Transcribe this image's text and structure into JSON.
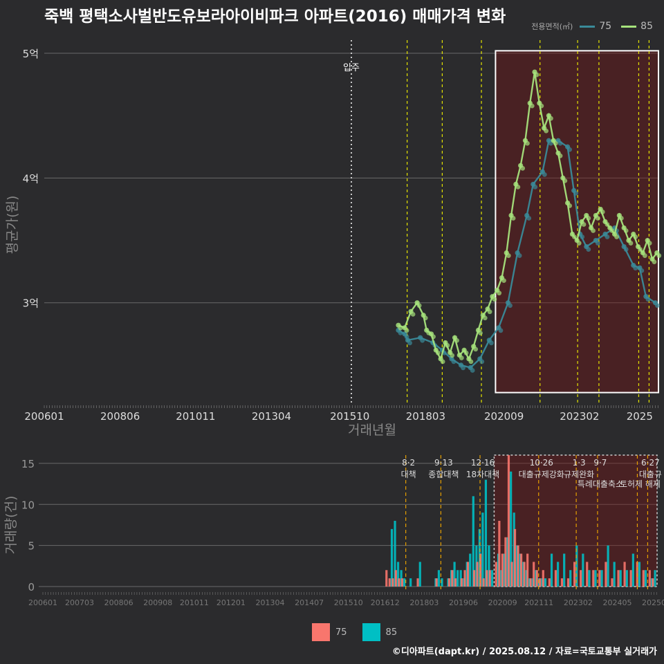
{
  "title": "죽백 평택소사벌반도유보라아이비파크 아파트(2016) 매매가격 변화",
  "legend": {
    "label": "전용면적(㎡)",
    "items": [
      {
        "name": "75",
        "line_color": "#3a8a99",
        "bar_color": "#f8766d"
      },
      {
        "name": "85",
        "line_color": "#a6e37c",
        "bar_color": "#00bfc4"
      }
    ]
  },
  "footer": "©디아파트(dapt.kr) / 2025.08.12 / 자료=국토교통부 실거래가",
  "chart_data": [
    {
      "type": "line",
      "xlabel": "거래년월",
      "ylabel": "평균가(원)",
      "ylim": [
        2.2,
        5.05
      ],
      "yticks": [
        {
          "v": 3,
          "label": "3억"
        },
        {
          "v": 4,
          "label": "4억"
        },
        {
          "v": 5,
          "label": "5억"
        }
      ],
      "xlim": [
        2006.0,
        2025.6
      ],
      "xticks": [
        {
          "v": 2006.0,
          "label": "200601"
        },
        {
          "v": 2008.42,
          "label": "200806"
        },
        {
          "v": 2010.83,
          "label": "201011"
        },
        {
          "v": 2013.25,
          "label": "201304"
        },
        {
          "v": 2015.75,
          "label": "201510"
        },
        {
          "v": 2018.17,
          "label": "201803"
        },
        {
          "v": 2020.67,
          "label": "202009"
        },
        {
          "v": 2023.08,
          "label": "202302"
        },
        {
          "v": 2025.0,
          "label": "2025"
        }
      ],
      "events": [
        {
          "x": 2015.8,
          "label": "입주",
          "style": "white"
        },
        {
          "x": 2017.58
        },
        {
          "x": 2018.7
        },
        {
          "x": 2019.95
        },
        {
          "x": 2021.82
        },
        {
          "x": 2023.02
        },
        {
          "x": 2023.7
        },
        {
          "x": 2024.97
        },
        {
          "x": 2025.3
        }
      ],
      "highlight": {
        "x0": 2020.4,
        "x1": 2025.6,
        "y0": 2.28,
        "y1": 5.02
      },
      "series": [
        {
          "name": "75",
          "color": "#3a8a99",
          "x": [
            2017.3,
            2017.5,
            2017.6,
            2018.0,
            2018.4,
            2018.7,
            2019.0,
            2019.3,
            2019.6,
            2019.9,
            2020.2,
            2020.5,
            2020.8,
            2021.1,
            2021.4,
            2021.6,
            2021.9,
            2022.1,
            2022.4,
            2022.7,
            2022.9,
            2023.1,
            2023.3,
            2023.6,
            2023.9,
            2024.2,
            2024.5,
            2024.8,
            2025.0,
            2025.2,
            2025.5
          ],
          "y": [
            2.78,
            2.75,
            2.7,
            2.72,
            2.68,
            2.62,
            2.55,
            2.5,
            2.48,
            2.55,
            2.7,
            2.8,
            3.0,
            3.4,
            3.7,
            3.95,
            4.05,
            4.3,
            4.3,
            4.25,
            3.9,
            3.55,
            3.45,
            3.5,
            3.55,
            3.6,
            3.45,
            3.3,
            3.28,
            3.05,
            3.0
          ]
        },
        {
          "name": "85",
          "color": "#a6e37c",
          "x": [
            2017.3,
            2017.5,
            2017.7,
            2017.9,
            2018.1,
            2018.2,
            2018.35,
            2018.5,
            2018.65,
            2018.8,
            2018.95,
            2019.1,
            2019.25,
            2019.4,
            2019.55,
            2019.7,
            2019.85,
            2020.0,
            2020.15,
            2020.3,
            2020.45,
            2020.6,
            2020.75,
            2020.9,
            2021.05,
            2021.2,
            2021.35,
            2021.5,
            2021.65,
            2021.8,
            2021.95,
            2022.1,
            2022.25,
            2022.4,
            2022.55,
            2022.7,
            2022.85,
            2023.0,
            2023.15,
            2023.3,
            2023.45,
            2023.6,
            2023.75,
            2023.9,
            2024.05,
            2024.2,
            2024.35,
            2024.5,
            2024.65,
            2024.8,
            2024.95,
            2025.1,
            2025.25,
            2025.4,
            2025.55
          ],
          "y": [
            2.82,
            2.8,
            2.93,
            3.0,
            2.9,
            2.78,
            2.75,
            2.62,
            2.55,
            2.68,
            2.6,
            2.72,
            2.58,
            2.62,
            2.55,
            2.65,
            2.78,
            2.9,
            2.95,
            3.05,
            3.1,
            3.2,
            3.4,
            3.7,
            3.95,
            4.1,
            4.3,
            4.6,
            4.85,
            4.6,
            4.4,
            4.5,
            4.3,
            4.2,
            4.0,
            3.8,
            3.55,
            3.5,
            3.65,
            3.7,
            3.6,
            3.7,
            3.75,
            3.65,
            3.6,
            3.55,
            3.7,
            3.6,
            3.5,
            3.55,
            3.45,
            3.4,
            3.5,
            3.35,
            3.4
          ]
        }
      ]
    },
    {
      "type": "bar",
      "ylabel": "거래량(건)",
      "ylim": [
        0,
        16
      ],
      "yticks": [
        0,
        5,
        10,
        15
      ],
      "xticks": [
        {
          "v": 2006.0,
          "label": "200601"
        },
        {
          "v": 2007.17,
          "label": "200703"
        },
        {
          "v": 2008.42,
          "label": "200806"
        },
        {
          "v": 2009.67,
          "label": "200908"
        },
        {
          "v": 2010.83,
          "label": "201011"
        },
        {
          "v": 2012.0,
          "label": "201201"
        },
        {
          "v": 2013.25,
          "label": "201304"
        },
        {
          "v": 2014.5,
          "label": "201407"
        },
        {
          "v": 2015.75,
          "label": "201510"
        },
        {
          "v": 2016.92,
          "label": "201612"
        },
        {
          "v": 2018.17,
          "label": "201803"
        },
        {
          "v": 2019.42,
          "label": "201906"
        },
        {
          "v": 2020.67,
          "label": "202009"
        },
        {
          "v": 2021.83,
          "label": "202111"
        },
        {
          "v": 2023.08,
          "label": "202302"
        },
        {
          "v": 2024.33,
          "label": "202405"
        },
        {
          "v": 2025.5,
          "label": "20250"
        }
      ],
      "policies": [
        {
          "x": 2017.58,
          "date": "8·2",
          "name": "대책"
        },
        {
          "x": 2018.7,
          "date": "9·13",
          "name": "종합대책"
        },
        {
          "x": 2019.95,
          "date": "12·16",
          "name": "18차대책"
        },
        {
          "x": 2021.82,
          "date": "10·26",
          "name": "대출규제강화"
        },
        {
          "x": 2023.02,
          "date": "1·3",
          "name": "규제완화"
        },
        {
          "x": 2023.7,
          "date": "9·7",
          "name": "특례대출축소"
        },
        {
          "x": 2024.97,
          "date": "",
          "name": "토허제 해제"
        },
        {
          "x": 2025.3,
          "date": "6·27",
          "name": "대출규"
        }
      ],
      "highlight": {
        "x0": 2020.4,
        "x1": 2025.6
      },
      "x": [
        2017.0,
        2017.1,
        2017.2,
        2017.3,
        2017.4,
        2017.5,
        2017.7,
        2018.0,
        2018.5,
        2018.6,
        2018.7,
        2018.9,
        2019.0,
        2019.1,
        2019.2,
        2019.3,
        2019.4,
        2019.5,
        2019.6,
        2019.7,
        2019.8,
        2019.9,
        2020.0,
        2020.1,
        2020.2,
        2020.3,
        2020.5,
        2020.6,
        2020.7,
        2020.8,
        2020.9,
        2021.0,
        2021.1,
        2021.2,
        2021.3,
        2021.4,
        2021.5,
        2021.6,
        2021.7,
        2021.8,
        2021.9,
        2022.0,
        2022.2,
        2022.4,
        2022.6,
        2022.8,
        2023.0,
        2023.2,
        2023.4,
        2023.6,
        2023.8,
        2024.0,
        2024.2,
        2024.4,
        2024.6,
        2024.8,
        2025.0,
        2025.2,
        2025.4,
        2025.5
      ],
      "series": [
        {
          "name": "75",
          "color": "#f8766d",
          "values": [
            2,
            1,
            1,
            2,
            1,
            1,
            0,
            1,
            0,
            1,
            0,
            0,
            1,
            2,
            1,
            0,
            1,
            2,
            3,
            0,
            2,
            3,
            4,
            1,
            2,
            2,
            3,
            8,
            4,
            6,
            16,
            3,
            7,
            5,
            4,
            3,
            4,
            1,
            3,
            2,
            1,
            2,
            1,
            2,
            1,
            1,
            3,
            2,
            3,
            2,
            2,
            3,
            1,
            2,
            3,
            2,
            3,
            2,
            2,
            1
          ]
        },
        {
          "name": "85",
          "color": "#00bfc4",
          "values": [
            0,
            7,
            8,
            3,
            2,
            1,
            1,
            3,
            1,
            2,
            1,
            1,
            2,
            3,
            2,
            2,
            1,
            3,
            4,
            11,
            5,
            7,
            9,
            13,
            5,
            2,
            4,
            2,
            4,
            6,
            14,
            9,
            5,
            4,
            3,
            2,
            1,
            1,
            2,
            1,
            1,
            1,
            4,
            3,
            4,
            2,
            5,
            4,
            2,
            2,
            2,
            5,
            3,
            2,
            2,
            4,
            3,
            2,
            1,
            2
          ]
        }
      ]
    }
  ]
}
